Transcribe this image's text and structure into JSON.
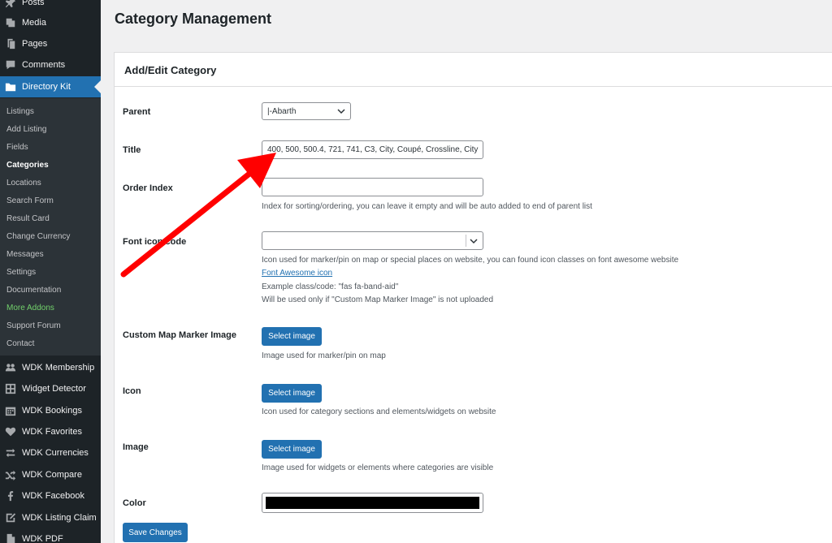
{
  "sidebar": {
    "top_items": [
      {
        "label": "Posts",
        "icon": "pin-icon"
      },
      {
        "label": "Media",
        "icon": "media-icon"
      },
      {
        "label": "Pages",
        "icon": "pages-icon"
      },
      {
        "label": "Comments",
        "icon": "comments-icon"
      },
      {
        "label": "Directory Kit",
        "icon": "folder-icon"
      }
    ],
    "submenu": [
      "Listings",
      "Add Listing",
      "Fields",
      "Categories",
      "Locations",
      "Search Form",
      "Result Card",
      "Change Currency",
      "Messages",
      "Settings",
      "Documentation",
      "More Addons",
      "Support Forum",
      "Contact"
    ],
    "bottom_items": [
      {
        "label": "WDK Membership",
        "icon": "membership-icon"
      },
      {
        "label": "Widget Detector",
        "icon": "widget-icon"
      },
      {
        "label": "WDK Bookings",
        "icon": "calendar-icon"
      },
      {
        "label": "WDK Favorites",
        "icon": "heart-icon"
      },
      {
        "label": "WDK Currencies",
        "icon": "exchange-icon"
      },
      {
        "label": "WDK Compare",
        "icon": "shuffle-icon"
      },
      {
        "label": "WDK Facebook",
        "icon": "facebook-icon"
      },
      {
        "label": "WDK Listing Claim",
        "icon": "claim-icon"
      },
      {
        "label": "WDK PDF",
        "icon": "pdf-icon"
      }
    ]
  },
  "page": {
    "title": "Category Management",
    "panel_title": "Add/Edit Category"
  },
  "form": {
    "parent": {
      "label": "Parent",
      "value": "|-Abarth"
    },
    "title": {
      "label": "Title",
      "value": "400, 500, 500.4, 721, 741, C3, City, Coupé, Crossline, City"
    },
    "order": {
      "label": "Order Index",
      "value": "",
      "desc": "Index for sorting/ordering, you can leave it empty and will be auto added to end of parent list"
    },
    "font_icon": {
      "label": "Font icon code",
      "value": "",
      "desc1": "Icon used for marker/pin on map or special places on website, you can found icon classes on font awesome website",
      "link": "Font Awesome icon",
      "desc2": "Example class/code: \"fas fa-band-aid\"",
      "desc3": "Will be used only if \"Custom Map Marker Image\" is not uploaded"
    },
    "marker": {
      "label": "Custom Map Marker Image",
      "button": "Select image",
      "desc": "Image used for marker/pin on map"
    },
    "icon": {
      "label": "Icon",
      "button": "Select image",
      "desc": "Icon used for category sections and elements/widgets on website"
    },
    "image": {
      "label": "Image",
      "button": "Select image",
      "desc": "Image used for widgets or elements where categories are visible"
    },
    "color": {
      "label": "Color",
      "value": "#000000"
    },
    "save_label": "Save Changes"
  },
  "colors": {
    "accent": "#2271b1",
    "sidebar_bg": "#1d2327",
    "arrow": "#ff0000"
  }
}
